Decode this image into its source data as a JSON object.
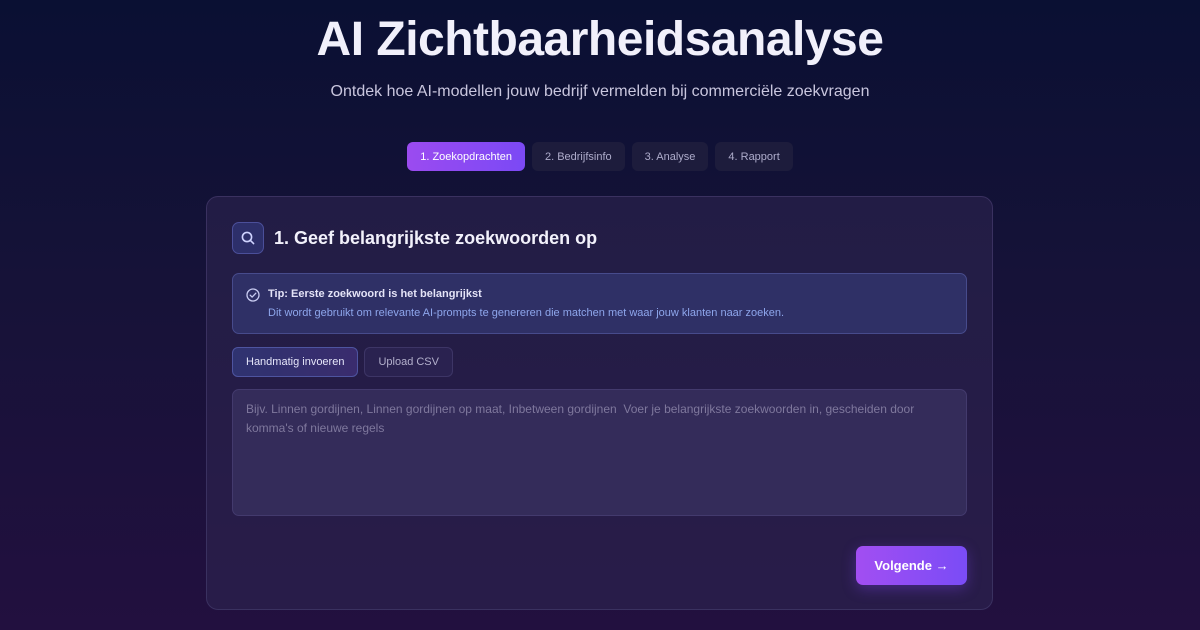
{
  "hero": {
    "title": "AI Zichtbaarheidsanalyse",
    "subtitle": "Ontdek hoe AI-modellen jouw bedrijf vermelden bij commerciële zoekvragen"
  },
  "steps": [
    {
      "label": "1. Zoekopdrachten",
      "active": true
    },
    {
      "label": "2. Bedrijfsinfo",
      "active": false
    },
    {
      "label": "3. Analyse",
      "active": false
    },
    {
      "label": "4. Rapport",
      "active": false
    }
  ],
  "card": {
    "icon": "search-icon",
    "title": "1. Geef belangrijkste zoekwoorden op",
    "tip": {
      "icon": "check-circle-icon",
      "title": "Tip: Eerste zoekwoord is het belangrijkst",
      "text": "Dit wordt gebruikt om relevante AI-prompts te genereren die matchen met waar jouw klanten naar zoeken."
    },
    "mode_tabs": [
      {
        "label": "Handmatig invoeren",
        "active": true
      },
      {
        "label": "Upload CSV",
        "active": false
      }
    ],
    "input": {
      "value": "",
      "placeholder": "Bijv. Linnen gordijnen, Linnen gordijnen op maat, Inbetween gordijnen  Voer je belangrijkste zoekwoorden in, gescheiden door komma's of nieuwe regels"
    },
    "next_label": "Volgende →"
  },
  "colors": {
    "accent": "#9b4bf0",
    "accent_secondary": "#7b49f5",
    "tip_text": "#8ea6ec"
  }
}
